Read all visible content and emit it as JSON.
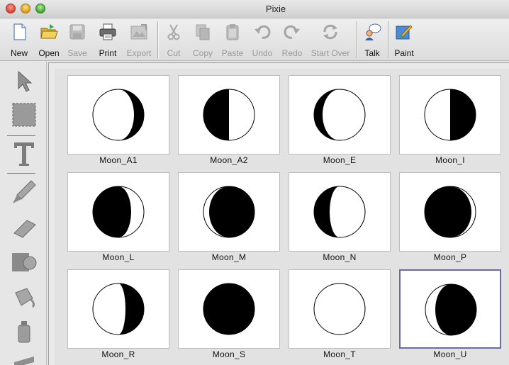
{
  "window": {
    "title": "Pixie"
  },
  "toolbar": {
    "new": "New",
    "open": "Open",
    "save": "Save",
    "print": "Print",
    "export": "Export",
    "cut": "Cut",
    "copy": "Copy",
    "paste": "Paste",
    "undo": "Undo",
    "redo": "Redo",
    "start_over": "Start Over",
    "talk": "Talk",
    "paint": "Paint"
  },
  "palette": [
    "arrow-select",
    "marquee-select",
    "text",
    "brush",
    "eraser",
    "shapes",
    "paint-bucket",
    "spray-can",
    "line"
  ],
  "gallery": [
    {
      "name": "Moon_A1",
      "phase": "crescent-right"
    },
    {
      "name": "Moon_A2",
      "phase": "half-left-dark"
    },
    {
      "name": "Moon_E",
      "phase": "crescent-left"
    },
    {
      "name": "Moon_I",
      "phase": "half-right-dark"
    },
    {
      "name": "Moon_L",
      "phase": "gibbous-left"
    },
    {
      "name": "Moon_M",
      "phase": "gibbous-large"
    },
    {
      "name": "Moon_N",
      "phase": "crescent-left-thick"
    },
    {
      "name": "Moon_P",
      "phase": "nearly-full"
    },
    {
      "name": "Moon_R",
      "phase": "crescent-right-thick"
    },
    {
      "name": "Moon_S",
      "phase": "full"
    },
    {
      "name": "Moon_T",
      "phase": "new"
    },
    {
      "name": "Moon_U",
      "phase": "gibbous-right"
    }
  ],
  "selected": "Moon_U",
  "colors": {
    "selection_border": "#6a6aa8"
  }
}
